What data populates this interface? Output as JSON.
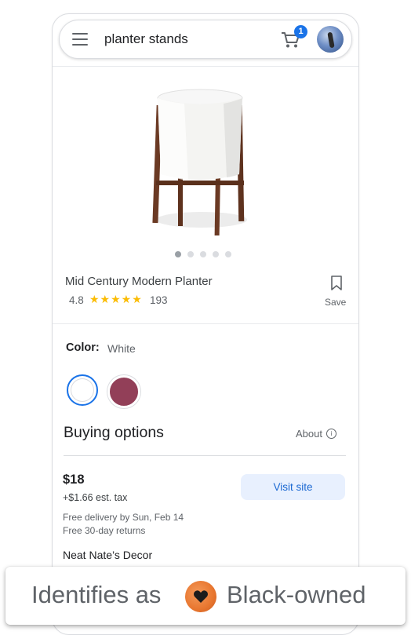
{
  "search": {
    "query": "planter stands"
  },
  "cart": {
    "count": "1"
  },
  "product": {
    "title": "Mid Century Modern Planter",
    "rating": "4.8",
    "stars": "★★★★★",
    "review_count": "193",
    "save_label": "Save",
    "image_count": 5,
    "active_image_index": 0
  },
  "color": {
    "label": "Color:",
    "selected": "White",
    "options": [
      {
        "name": "White",
        "hex": "#ffffff"
      },
      {
        "name": "Plum",
        "hex": "#923f58"
      }
    ]
  },
  "buying": {
    "title": "Buying options",
    "about_label": "About",
    "offer": {
      "price": "$18",
      "tax": "+$1.66 est. tax",
      "delivery": "Free delivery by Sun, Feb 14",
      "returns": "Free 30-day returns",
      "button_label": "Visit site",
      "seller": "Neat Nate’s Decor"
    }
  },
  "overlay": {
    "prefix": "Identifies as",
    "suffix": "Black-owned"
  },
  "colors": {
    "accent": "#1a73e8",
    "button_bg": "#e8f0fe",
    "star": "#fbbc04",
    "badge_orange": "#e8762f"
  }
}
